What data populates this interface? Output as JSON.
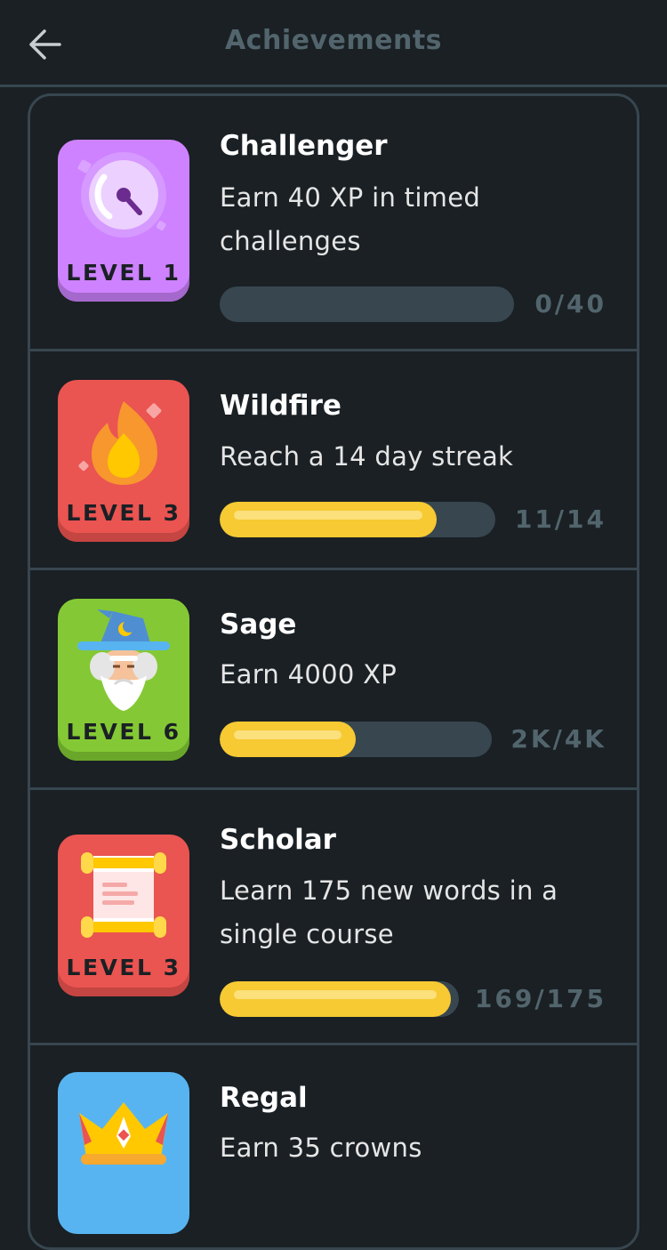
{
  "header": {
    "title": "Achievements",
    "back_icon": "arrow-left-icon"
  },
  "achievements": [
    {
      "name": "Challenger",
      "description": "Earn 40 XP in timed challenges",
      "level_label": "LEVEL 1",
      "progress_text": "0/40",
      "progress_fraction": 0.0,
      "badge_color": "#ce82ff",
      "icon": "stopwatch-icon"
    },
    {
      "name": "Wildfire",
      "description": "Reach a 14 day streak",
      "level_label": "LEVEL 3",
      "progress_text": "11/14",
      "progress_fraction": 0.786,
      "badge_color": "#ea5451",
      "icon": "flame-icon"
    },
    {
      "name": "Sage",
      "description": "Earn 4000 XP",
      "level_label": "LEVEL 6",
      "progress_text": "2K/4K",
      "progress_fraction": 0.5,
      "badge_color": "#84c935",
      "icon": "wizard-icon"
    },
    {
      "name": "Scholar",
      "description": "Learn 175 new words in a single course",
      "level_label": "LEVEL 3",
      "progress_text": "169/175",
      "progress_fraction": 0.966,
      "badge_color": "#ea5451",
      "icon": "scroll-icon"
    },
    {
      "name": "Regal",
      "description": "Earn 35 crowns",
      "badge_color": "#58b4f0",
      "icon": "crown-icon"
    }
  ],
  "colors": {
    "background": "#1a2024",
    "border": "#37464f",
    "muted_text": "#52656d",
    "progress_fill": "#f7c932",
    "progress_track": "#37464f"
  }
}
